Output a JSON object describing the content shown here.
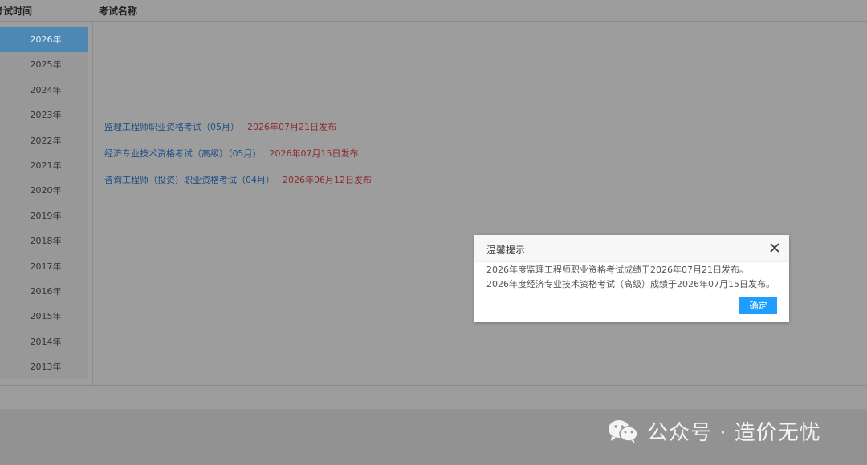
{
  "table": {
    "col_time_header": "考试时间",
    "col_name_header": "考试名称"
  },
  "years": [
    "2026年",
    "2025年",
    "2024年",
    "2023年",
    "2022年",
    "2021年",
    "2020年",
    "2019年",
    "2018年",
    "2017年",
    "2016年",
    "2015年",
    "2014年",
    "2013年"
  ],
  "selected_year": "2026年",
  "exams": [
    {
      "name": "监理工程师职业资格考试（05月）",
      "release": "2026年07月21日发布"
    },
    {
      "name": "经济专业技术资格考试（高级）（05月）",
      "release": "2026年07月15日发布"
    },
    {
      "name": "咨询工程师（投资）职业资格考试（04月）",
      "release": "2026年06月12日发布"
    }
  ],
  "modal": {
    "title": "温馨提示",
    "lines": [
      "2026年度监理工程师职业资格考试成绩于2026年07月21日发布。",
      "2026年度经济专业技术资格考试（高级）成绩于2026年07月15日发布。"
    ],
    "ok_label": "确定",
    "close_icon": "close-icon"
  },
  "watermark": {
    "text": "公众号 · 造价无忧",
    "icon": "wechat-icon"
  },
  "colors": {
    "accent": "#1e9fff",
    "link": "#1e4f86",
    "date": "#8c2a2a",
    "active_year": "#4d87b3"
  }
}
